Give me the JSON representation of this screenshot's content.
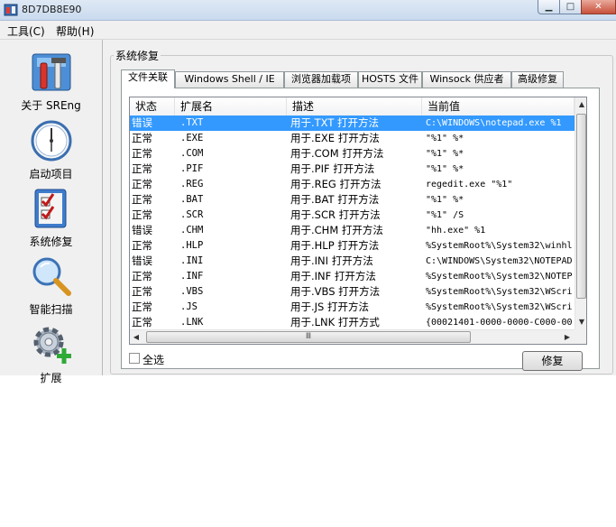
{
  "window": {
    "title": "8D7DB8E90"
  },
  "menu": {
    "tools": "工具(C)",
    "help": "帮助(H)"
  },
  "sidebar": {
    "items": [
      {
        "label": "关于 SREng",
        "icon": "tools-icon"
      },
      {
        "label": "启动项目",
        "icon": "clock-icon"
      },
      {
        "label": "系统修复",
        "icon": "checklist-icon"
      },
      {
        "label": "智能扫描",
        "icon": "magnifier-icon"
      },
      {
        "label": "扩展",
        "icon": "gear-plus-icon"
      }
    ]
  },
  "main": {
    "group_title": "系统修复",
    "tabs": [
      {
        "label": "文件关联",
        "active": true
      },
      {
        "label": "Windows Shell / IE"
      },
      {
        "label": "浏览器加载项"
      },
      {
        "label": "HOSTS 文件"
      },
      {
        "label": "Winsock 供应者"
      },
      {
        "label": "高级修复"
      }
    ],
    "list": {
      "columns": [
        "状态",
        "扩展名",
        "描述",
        "当前值"
      ],
      "rows": [
        {
          "status": "错误",
          "ext": ".TXT",
          "desc": "用于.TXT 打开方法",
          "value": "C:\\WINDOWS\\notepad.exe %1",
          "selected": true
        },
        {
          "status": "正常",
          "ext": ".EXE",
          "desc": "用于.EXE 打开方法",
          "value": "\"%1\" %*"
        },
        {
          "status": "正常",
          "ext": ".COM",
          "desc": "用于.COM 打开方法",
          "value": "\"%1\" %*"
        },
        {
          "status": "正常",
          "ext": ".PIF",
          "desc": "用于.PIF 打开方法",
          "value": "\"%1\" %*"
        },
        {
          "status": "正常",
          "ext": ".REG",
          "desc": "用于.REG 打开方法",
          "value": "regedit.exe \"%1\""
        },
        {
          "status": "正常",
          "ext": ".BAT",
          "desc": "用于.BAT 打开方法",
          "value": "\"%1\" %*"
        },
        {
          "status": "正常",
          "ext": ".SCR",
          "desc": "用于.SCR 打开方法",
          "value": "\"%1\" /S"
        },
        {
          "status": "错误",
          "ext": ".CHM",
          "desc": "用于.CHM 打开方法",
          "value": "\"hh.exe\" %1"
        },
        {
          "status": "正常",
          "ext": ".HLP",
          "desc": "用于.HLP 打开方法",
          "value": "%SystemRoot%\\System32\\winhl"
        },
        {
          "status": "错误",
          "ext": ".INI",
          "desc": "用于.INI 打开方法",
          "value": "C:\\WINDOWS\\System32\\NOTEPAD"
        },
        {
          "status": "正常",
          "ext": ".INF",
          "desc": "用于.INF 打开方法",
          "value": "%SystemRoot%\\System32\\NOTEP"
        },
        {
          "status": "正常",
          "ext": ".VBS",
          "desc": "用于.VBS 打开方法",
          "value": "%SystemRoot%\\System32\\WScri"
        },
        {
          "status": "正常",
          "ext": ".JS",
          "desc": "用于.JS 打开方法",
          "value": "%SystemRoot%\\System32\\WScri"
        },
        {
          "status": "正常",
          "ext": ".LNK",
          "desc": "用于.LNK 打开方式",
          "value": "{00021401-0000-0000-C000-00"
        }
      ]
    },
    "select_all_label": "全选",
    "repair_button": "修复",
    "scroll_grip": "Ⅲ"
  },
  "colors": {
    "selection": "#3399ff",
    "titlebar": "#c9daee",
    "panel": "#f0f0f0"
  }
}
